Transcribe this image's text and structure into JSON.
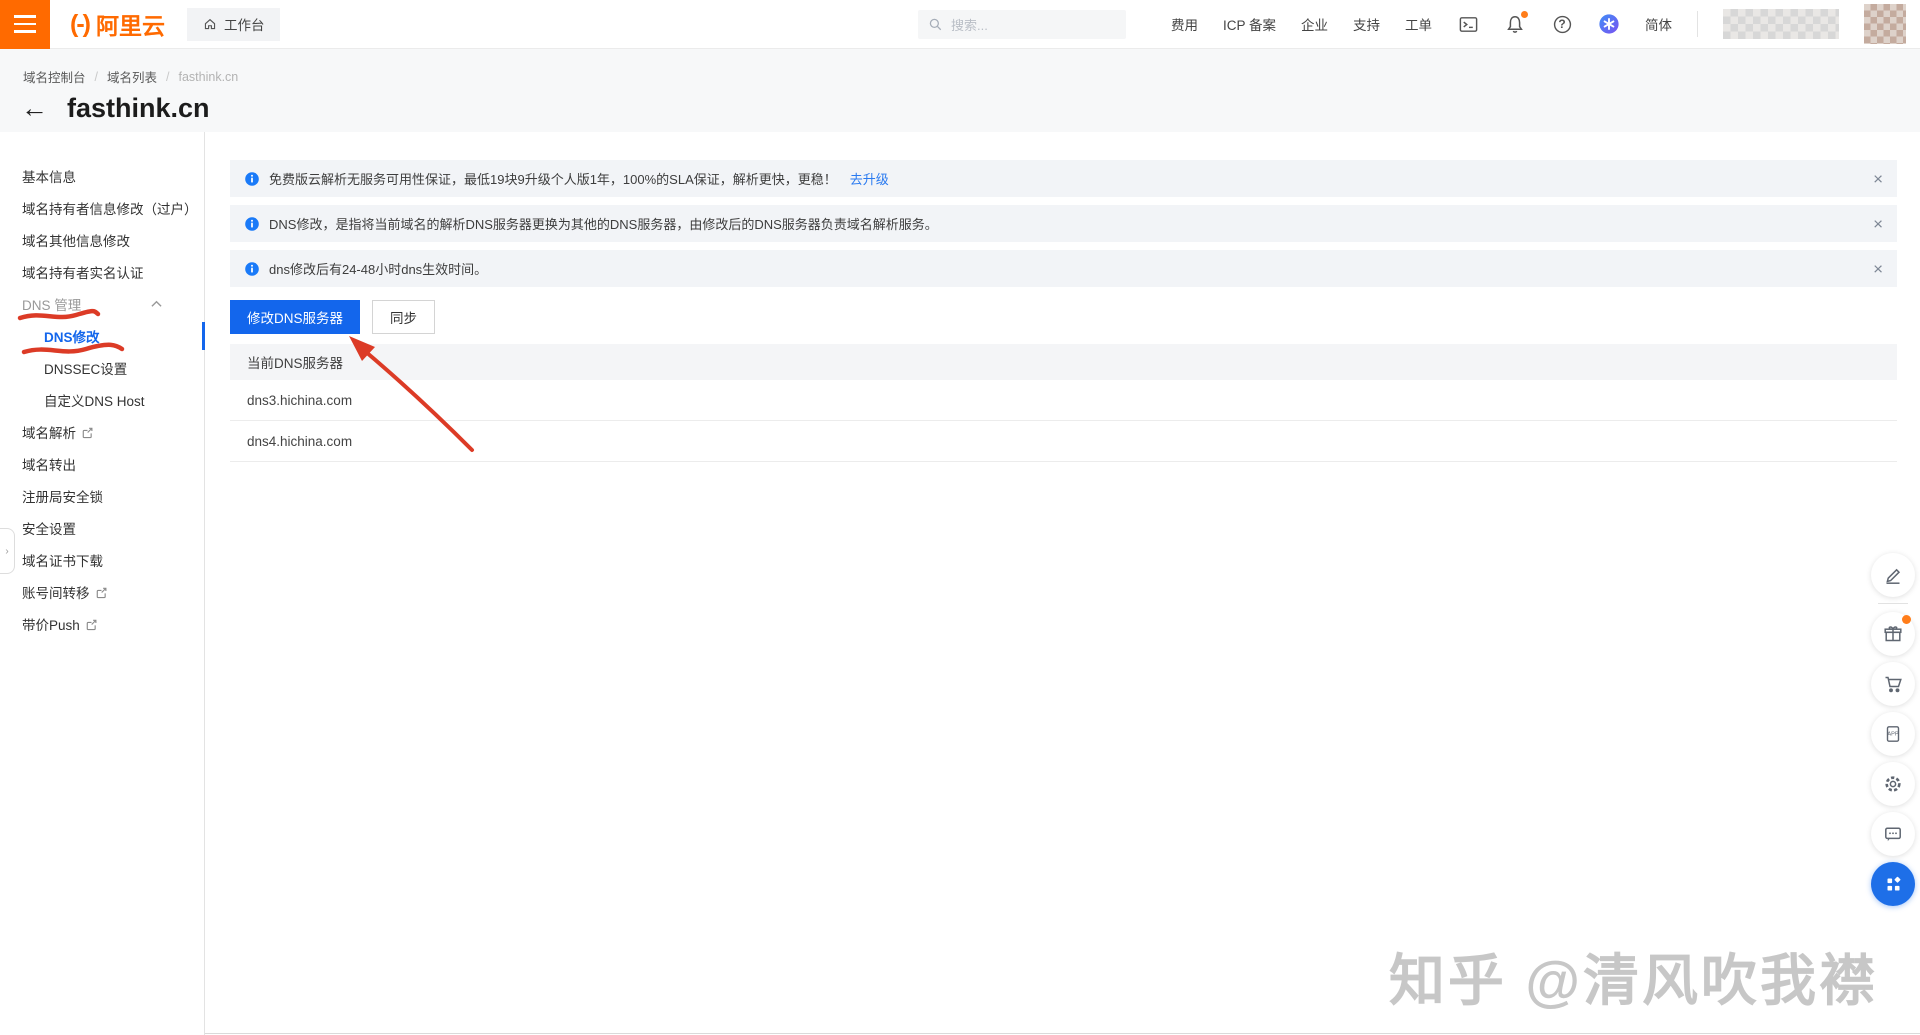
{
  "header": {
    "logo_mark": "(-)",
    "logo_text": "阿里云",
    "workbench_label": "工作台",
    "search_placeholder": "搜索...",
    "nav": [
      "费用",
      "ICP 备案",
      "企业",
      "支持",
      "工单"
    ],
    "lang_label": "简体"
  },
  "breadcrumb": {
    "items": [
      "域名控制台",
      "域名列表",
      "fasthink.cn"
    ]
  },
  "page": {
    "back_arrow": "←",
    "title": "fasthink.cn"
  },
  "sidebar": {
    "items": [
      {
        "label": "基本信息"
      },
      {
        "label": "域名持有者信息修改（过户）"
      },
      {
        "label": "域名其他信息修改"
      },
      {
        "label": "域名持有者实名认证"
      },
      {
        "label": "DNS 管理"
      },
      {
        "label": "DNS修改"
      },
      {
        "label": "DNSSEC设置"
      },
      {
        "label": "自定义DNS Host"
      },
      {
        "label": "域名解析"
      },
      {
        "label": "域名转出"
      },
      {
        "label": "注册局安全锁"
      },
      {
        "label": "安全设置"
      },
      {
        "label": "域名证书下载"
      },
      {
        "label": "账号间转移"
      },
      {
        "label": "带价Push"
      }
    ]
  },
  "banners": [
    {
      "text": "免费版云解析无服务可用性保证，最低19块9升级个人版1年，100%的SLA保证，解析更快，更稳！",
      "link": "去升级",
      "close": "×"
    },
    {
      "text": "DNS修改，是指将当前域名的解析DNS服务器更换为其他的DNS服务器，由修改后的DNS服务器负责域名解析服务。",
      "close": "×"
    },
    {
      "text": "dns修改后有24-48小时dns生效时间。",
      "close": "×"
    }
  ],
  "actions": {
    "modify_dns": "修改DNS服务器",
    "sync": "同步"
  },
  "dns_table": {
    "header": "当前DNS服务器",
    "rows": [
      "dns3.hichina.com",
      "dns4.hichina.com"
    ]
  },
  "misc": {
    "collapse_glyph": "›",
    "help_glyph": "?"
  },
  "watermark": "知乎 @清风吹我襟",
  "colors": {
    "brand_orange": "#ff6a00",
    "primary_blue": "#1366ec",
    "link_blue": "#2a7af0",
    "info_blue": "#1a7af8",
    "annotation_red": "#dc3b26",
    "banner_bg": "#f2f4f7"
  }
}
